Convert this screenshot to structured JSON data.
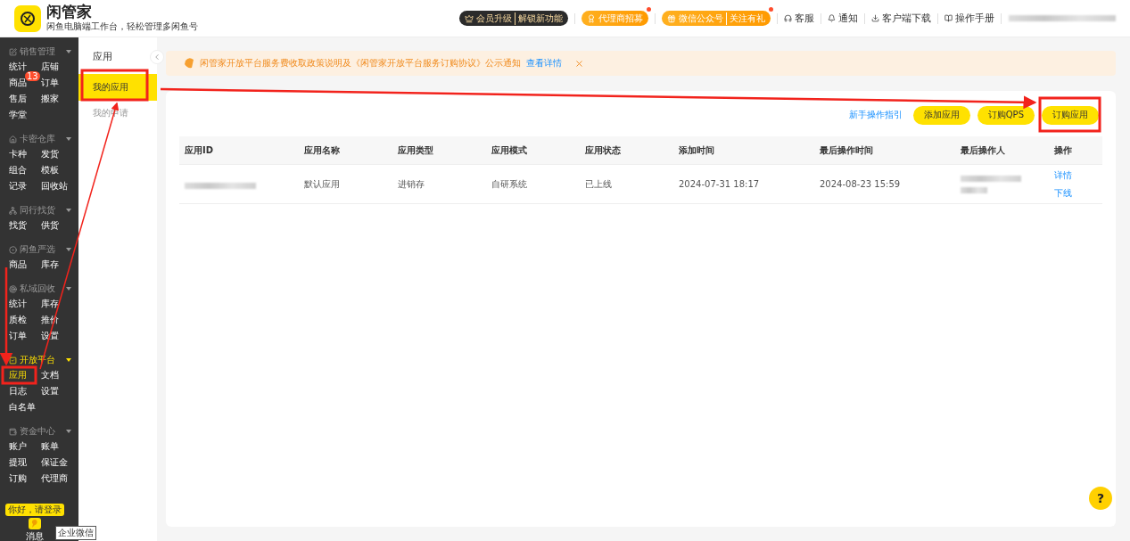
{
  "header": {
    "logo_title": "闲管家",
    "logo_subtitle": "闲鱼电脑端工作台，轻松管理多闲鱼号",
    "promos": [
      {
        "kind": "vip",
        "label": "会员升级",
        "sublabel": "解锁新功能",
        "dot": false
      },
      {
        "kind": "agent",
        "label": "代理商招募",
        "dot": true
      },
      {
        "kind": "wechat",
        "label": "微信公众号",
        "sublabel": "关注有礼",
        "dot": true
      }
    ],
    "links": [
      "客服",
      "通知",
      "客户端下载",
      "操作手册"
    ],
    "user_redacted": true
  },
  "sidebar": {
    "groups": [
      {
        "title": "销售管理",
        "active": false,
        "items": [
          {
            "label": "统计",
            "selected": false
          },
          {
            "label": "店铺",
            "selected": false
          },
          {
            "label": "商品",
            "selected": false,
            "badge": "13"
          },
          {
            "label": "订单",
            "selected": false
          },
          {
            "label": "售后",
            "selected": false
          },
          {
            "label": "搬家",
            "selected": false
          },
          {
            "label": "学堂",
            "selected": false
          }
        ]
      },
      {
        "title": "卡密仓库",
        "active": false,
        "items": [
          {
            "label": "卡种",
            "selected": false
          },
          {
            "label": "发货",
            "selected": false
          },
          {
            "label": "组合",
            "selected": false
          },
          {
            "label": "模板",
            "selected": false
          },
          {
            "label": "记录",
            "selected": false
          },
          {
            "label": "回收站",
            "selected": false
          }
        ]
      },
      {
        "title": "同行找货",
        "active": false,
        "items": [
          {
            "label": "找货",
            "selected": false
          },
          {
            "label": "供货",
            "selected": false
          }
        ]
      },
      {
        "title": "闲鱼严选",
        "active": false,
        "items": [
          {
            "label": "商品",
            "selected": false
          },
          {
            "label": "库存",
            "selected": false
          }
        ]
      },
      {
        "title": "私域回收",
        "active": false,
        "items": [
          {
            "label": "统计",
            "selected": false
          },
          {
            "label": "库存",
            "selected": false
          },
          {
            "label": "质检",
            "selected": false
          },
          {
            "label": "推价",
            "selected": false
          },
          {
            "label": "订单",
            "selected": false
          },
          {
            "label": "设置",
            "selected": false
          }
        ]
      },
      {
        "title": "开放平台",
        "active": true,
        "items": [
          {
            "label": "应用",
            "selected": true
          },
          {
            "label": "文档",
            "selected": false
          },
          {
            "label": "日志",
            "selected": false
          },
          {
            "label": "设置",
            "selected": false
          },
          {
            "label": "白名单",
            "selected": false
          }
        ]
      },
      {
        "title": "资金中心",
        "active": false,
        "items": [
          {
            "label": "账户",
            "selected": false
          },
          {
            "label": "账单",
            "selected": false
          },
          {
            "label": "提现",
            "selected": false
          },
          {
            "label": "保证金",
            "selected": false
          },
          {
            "label": "订购",
            "selected": false
          },
          {
            "label": "代理商",
            "selected": false
          }
        ]
      }
    ],
    "login_tip": "你好，请登录",
    "message_label": "消息",
    "tooltip": "企业微信"
  },
  "subnav": {
    "title": "应用",
    "items": [
      {
        "label": "我的应用",
        "selected": true
      },
      {
        "label": "我的申请",
        "selected": false
      }
    ]
  },
  "notice": {
    "text": "闲管家开放平台服务费收取政策说明及《闲管家开放平台服务订购协议》公示通知",
    "link": "查看详情"
  },
  "toolbar": {
    "guide_link": "新手操作指引",
    "buttons": [
      "添加应用",
      "订购QPS",
      "订购应用"
    ]
  },
  "table": {
    "columns": [
      "应用ID",
      "应用名称",
      "应用类型",
      "应用模式",
      "应用状态",
      "添加时间",
      "最后操作时间",
      "最后操作人",
      "操作"
    ],
    "rows": [
      {
        "app_id_redacted": true,
        "name": "默认应用",
        "type": "进销存",
        "mode": "自研系统",
        "status": "已上线",
        "added": "2024-07-31 18:17",
        "last_time": "2024-08-23 15:59",
        "operator_redacted": true,
        "actions": [
          "详情",
          "下线"
        ]
      }
    ]
  },
  "help_button": "?"
}
